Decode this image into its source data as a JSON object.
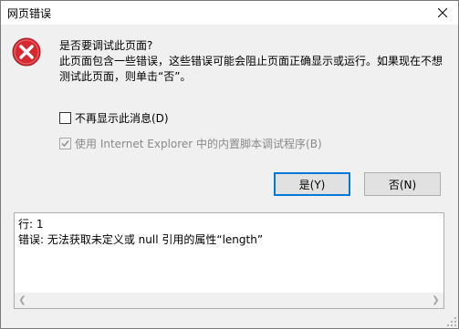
{
  "window": {
    "title": "网页错误"
  },
  "message": {
    "question": "是否要调试此页面?",
    "line1": "此页面包含一些错误，这些错误可能会阻止页面正确显示或运行。如果现在不想",
    "line2": "测试此页面，则单击“否”。"
  },
  "checkboxes": {
    "dont_show": {
      "label": "不再显示此消息(D)",
      "checked": false
    },
    "use_ie_debugger": {
      "label": "使用 Internet Explorer 中的内置脚本调试程序(B)",
      "checked": true,
      "disabled": true
    }
  },
  "buttons": {
    "yes": "是(Y)",
    "no": "否(N)"
  },
  "details": {
    "line": "行: 1",
    "error": "错误: 无法获取未定义或 null 引用的属性“length”"
  },
  "icons": {
    "error": "error-icon",
    "close": "close-icon"
  },
  "colors": {
    "error_red": "#d7282f",
    "primary_border": "#0078d7"
  }
}
